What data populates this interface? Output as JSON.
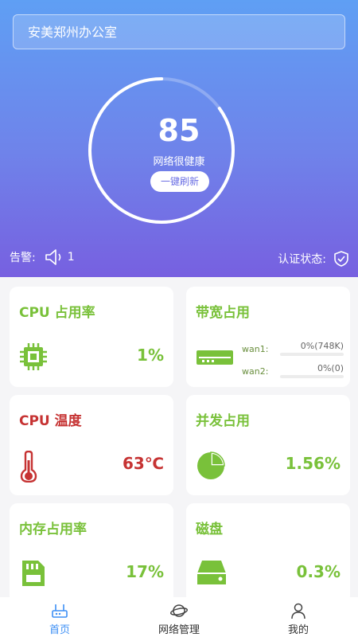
{
  "header": {
    "location": "安美郑州办公室"
  },
  "gauge": {
    "score": "85",
    "status": "网络很健康",
    "refresh_label": "一键刷新",
    "progress": 0.85
  },
  "footer_info": {
    "alarm_label": "告警:",
    "alarm_count": "1",
    "auth_label": "认证状态:"
  },
  "cards": {
    "cpu": {
      "title": "CPU 占用率",
      "value": "1%"
    },
    "bandwidth": {
      "title": "带宽占用",
      "wan1_label": "wan1:",
      "wan1_value": "0%(748K)",
      "wan2_label": "wan2:",
      "wan2_value": "0%(0)"
    },
    "temp": {
      "title": "CPU 温度",
      "value": "63℃"
    },
    "concurrency": {
      "title": "并发占用",
      "value": "1.56%"
    },
    "memory": {
      "title": "内存占用率",
      "value": "17%"
    },
    "disk": {
      "title": "磁盘",
      "value": "0.3%"
    }
  },
  "tabbar": {
    "home": "首页",
    "network": "网络管理",
    "mine": "我的"
  },
  "colors": {
    "accent_green": "#79c13a",
    "accent_red": "#c63333",
    "tab_active": "#3d8ff5"
  }
}
